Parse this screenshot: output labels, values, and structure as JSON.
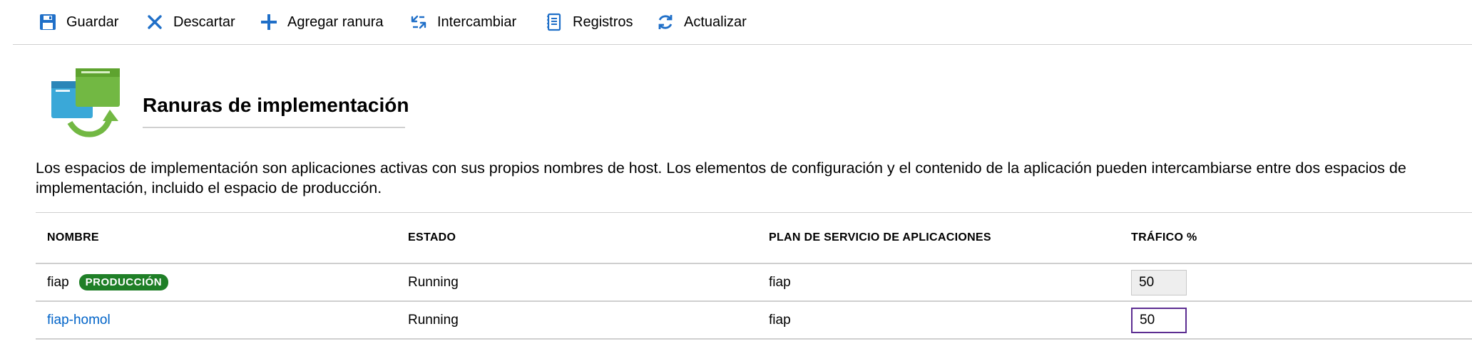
{
  "toolbar": {
    "items": [
      {
        "label": "Guardar",
        "icon": "save-icon"
      },
      {
        "label": "Descartar",
        "icon": "close-icon"
      },
      {
        "label": "Agregar ranura",
        "icon": "plus-icon"
      },
      {
        "label": "Intercambiar",
        "icon": "swap-icon"
      },
      {
        "label": "Registros",
        "icon": "log-icon"
      },
      {
        "label": "Actualizar",
        "icon": "refresh-icon"
      }
    ]
  },
  "header": {
    "title": "Ranuras de implementación",
    "icon": "deployment-slots-icon"
  },
  "description": "Los espacios de implementación son aplicaciones activas con sus propios nombres de host. Los elementos de configuración y el contenido de la aplicación pueden intercambiarse entre dos espacios de implementación, incluido el espacio de producción.",
  "table": {
    "columns": [
      "NOMBRE",
      "ESTADO",
      "PLAN DE SERVICIO DE APLICACIONES",
      "TRÁFICO %"
    ],
    "rows": [
      {
        "name": "fiap",
        "badge": "PRODUCCIÓN",
        "status": "Running",
        "plan": "fiap",
        "traffic": "50"
      },
      {
        "name": "fiap-homol",
        "badge": "",
        "status": "Running",
        "plan": "fiap",
        "traffic": "50"
      }
    ]
  },
  "colors": {
    "accent_blue": "#0063c8",
    "badge_green": "#1f7f27",
    "focus_purple": "#5c2d91"
  }
}
